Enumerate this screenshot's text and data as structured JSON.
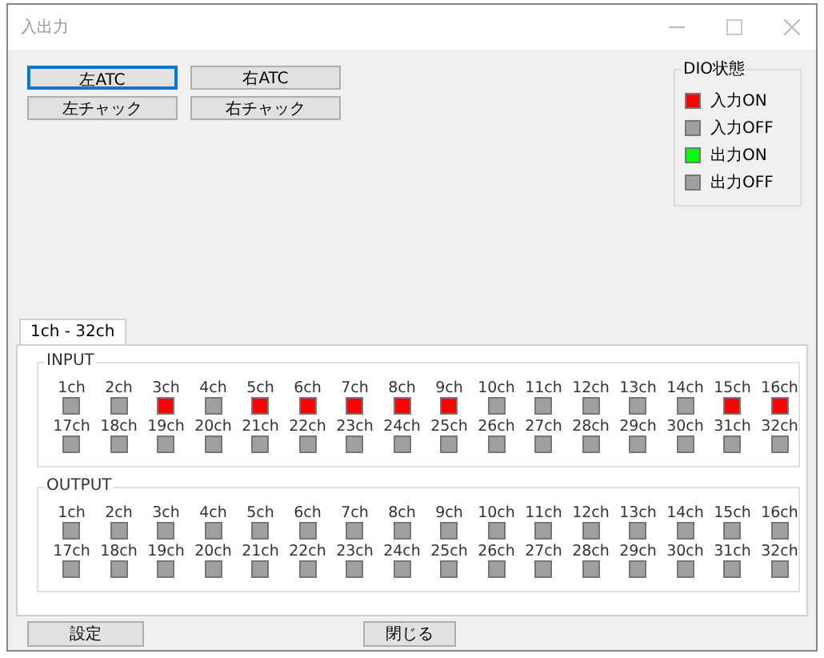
{
  "window": {
    "title": "入出力"
  },
  "top_buttons": [
    {
      "label": "左ATC",
      "focused": true
    },
    {
      "label": "右ATC",
      "focused": false
    },
    {
      "label": "左チャック",
      "focused": false
    },
    {
      "label": "右チャック",
      "focused": false
    }
  ],
  "legend": {
    "title": "DIO状態",
    "items": [
      {
        "label": "入力ON",
        "color": "#ff0000"
      },
      {
        "label": "入力OFF",
        "color": "#a0a0a0"
      },
      {
        "label": "出力ON",
        "color": "#00ff00"
      },
      {
        "label": "出力OFF",
        "color": "#a0a0a0"
      }
    ]
  },
  "tabs": [
    {
      "label": "1ch - 32ch",
      "selected": true
    }
  ],
  "groups": [
    {
      "title": "INPUT",
      "kind": "input",
      "channels": [
        {
          "label": "1ch",
          "on": false
        },
        {
          "label": "2ch",
          "on": false
        },
        {
          "label": "3ch",
          "on": true
        },
        {
          "label": "4ch",
          "on": false
        },
        {
          "label": "5ch",
          "on": true
        },
        {
          "label": "6ch",
          "on": true
        },
        {
          "label": "7ch",
          "on": true
        },
        {
          "label": "8ch",
          "on": true
        },
        {
          "label": "9ch",
          "on": true
        },
        {
          "label": "10ch",
          "on": false
        },
        {
          "label": "11ch",
          "on": false
        },
        {
          "label": "12ch",
          "on": false
        },
        {
          "label": "13ch",
          "on": false
        },
        {
          "label": "14ch",
          "on": false
        },
        {
          "label": "15ch",
          "on": true
        },
        {
          "label": "16ch",
          "on": true
        },
        {
          "label": "17ch",
          "on": false
        },
        {
          "label": "18ch",
          "on": false
        },
        {
          "label": "19ch",
          "on": false
        },
        {
          "label": "20ch",
          "on": false
        },
        {
          "label": "21ch",
          "on": false
        },
        {
          "label": "22ch",
          "on": false
        },
        {
          "label": "23ch",
          "on": false
        },
        {
          "label": "24ch",
          "on": false
        },
        {
          "label": "25ch",
          "on": false
        },
        {
          "label": "26ch",
          "on": false
        },
        {
          "label": "27ch",
          "on": false
        },
        {
          "label": "28ch",
          "on": false
        },
        {
          "label": "29ch",
          "on": false
        },
        {
          "label": "30ch",
          "on": false
        },
        {
          "label": "31ch",
          "on": false
        },
        {
          "label": "32ch",
          "on": false
        }
      ]
    },
    {
      "title": "OUTPUT",
      "kind": "output",
      "channels": [
        {
          "label": "1ch",
          "on": false
        },
        {
          "label": "2ch",
          "on": false
        },
        {
          "label": "3ch",
          "on": false
        },
        {
          "label": "4ch",
          "on": false
        },
        {
          "label": "5ch",
          "on": false
        },
        {
          "label": "6ch",
          "on": false
        },
        {
          "label": "7ch",
          "on": false
        },
        {
          "label": "8ch",
          "on": false
        },
        {
          "label": "9ch",
          "on": false
        },
        {
          "label": "10ch",
          "on": false
        },
        {
          "label": "11ch",
          "on": false
        },
        {
          "label": "12ch",
          "on": false
        },
        {
          "label": "13ch",
          "on": false
        },
        {
          "label": "14ch",
          "on": false
        },
        {
          "label": "15ch",
          "on": false
        },
        {
          "label": "16ch",
          "on": false
        },
        {
          "label": "17ch",
          "on": false
        },
        {
          "label": "18ch",
          "on": false
        },
        {
          "label": "19ch",
          "on": false
        },
        {
          "label": "20ch",
          "on": false
        },
        {
          "label": "21ch",
          "on": false
        },
        {
          "label": "22ch",
          "on": false
        },
        {
          "label": "23ch",
          "on": false
        },
        {
          "label": "24ch",
          "on": false
        },
        {
          "label": "25ch",
          "on": false
        },
        {
          "label": "26ch",
          "on": false
        },
        {
          "label": "27ch",
          "on": false
        },
        {
          "label": "28ch",
          "on": false
        },
        {
          "label": "29ch",
          "on": false
        },
        {
          "label": "30ch",
          "on": false
        },
        {
          "label": "31ch",
          "on": false
        },
        {
          "label": "32ch",
          "on": false
        }
      ]
    }
  ],
  "bottom_buttons": [
    "設定",
    "閉じる"
  ]
}
